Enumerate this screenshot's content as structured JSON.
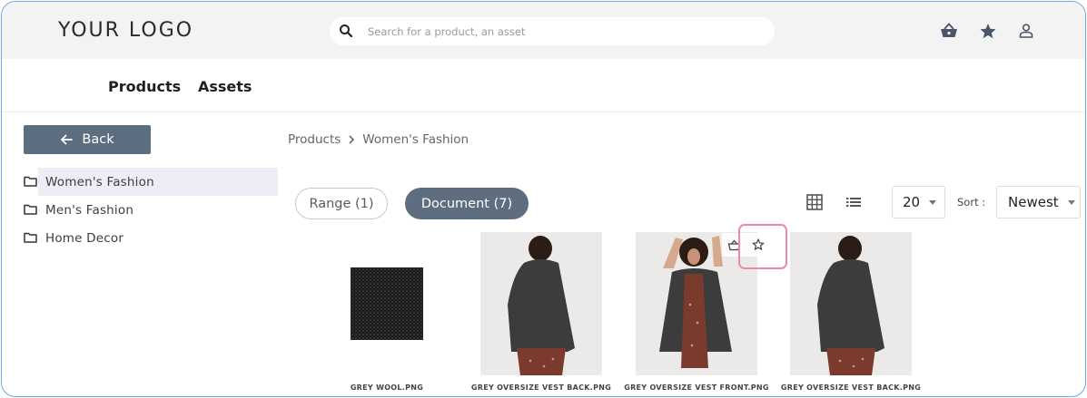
{
  "header": {
    "logo": "YOUR LOGO",
    "search_placeholder": "Search for a product, an asset",
    "icons": [
      "basket-icon",
      "star-icon",
      "user-icon"
    ]
  },
  "nav": {
    "products": "Products",
    "assets": "Assets"
  },
  "sidebar": {
    "back_label": "Back",
    "folders": [
      {
        "label": "Women's Fashion",
        "active": true
      },
      {
        "label": "Men's Fashion",
        "active": false
      },
      {
        "label": "Home Decor",
        "active": false
      }
    ]
  },
  "breadcrumb": {
    "root": "Products",
    "current": "Women's Fashion"
  },
  "filters": {
    "range": "Range (1)",
    "document": "Document (7)"
  },
  "controls": {
    "per_page": "20",
    "sort_label": "Sort :",
    "sort_value": "Newest"
  },
  "products": [
    {
      "caption": "GREY WOOL.PNG"
    },
    {
      "caption": "GREY OVERSIZE VEST BACK.PNG"
    },
    {
      "caption": "GREY OVERSIZE VEST FRONT.PNG"
    },
    {
      "caption": "GREY OVERSIZE VEST BACK.PNG"
    }
  ],
  "colors": {
    "accent": "#5d6e80",
    "highlight": "#ec8aa6",
    "frame": "#6aa8e6"
  }
}
